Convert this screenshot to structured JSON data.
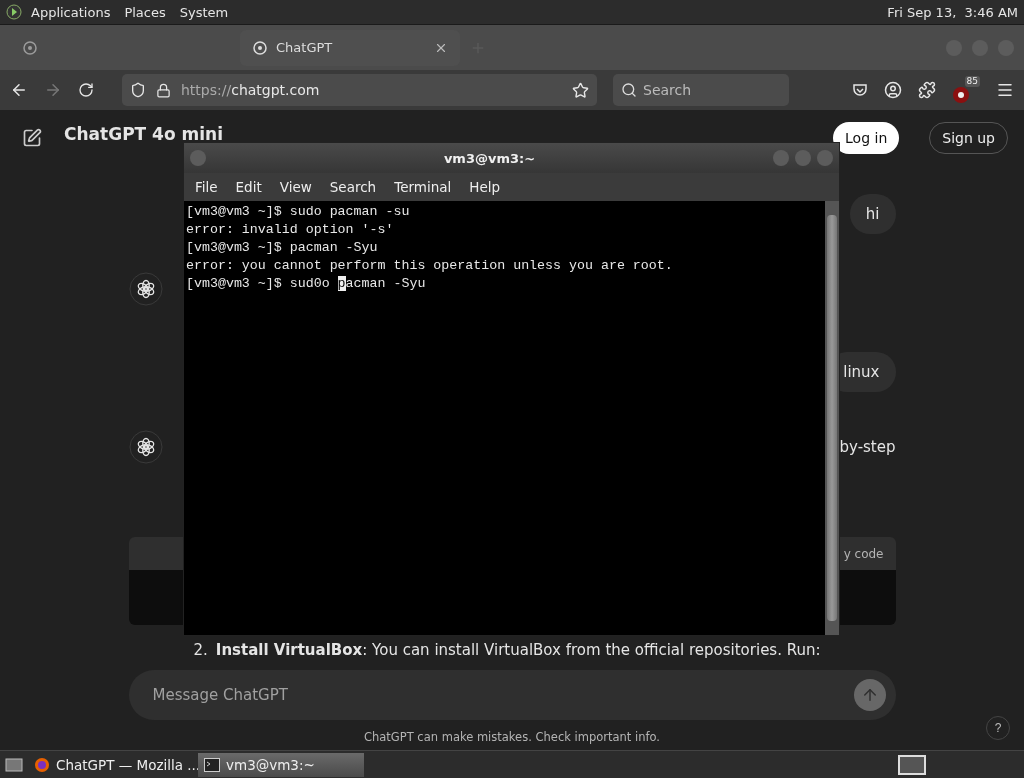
{
  "top_panel": {
    "menus": [
      "Applications",
      "Places",
      "System"
    ],
    "clock": "Fri Sep 13,  3:46 AM"
  },
  "browser": {
    "tabs": [
      {
        "selected": false
      },
      {
        "title": "ChatGPT",
        "selected": true
      }
    ],
    "url_scheme": "https://",
    "url_host": "chatgpt.com",
    "search_placeholder": "Search",
    "extension_badge": "85"
  },
  "chat": {
    "model": "ChatGPT 4o mini",
    "login": "Log in",
    "signup": "Sign up",
    "messages": [
      {
        "kind": "user",
        "text": "hi"
      },
      {
        "kind": "assistant"
      },
      {
        "kind": "user",
        "text": "linux"
      },
      {
        "kind": "assistant",
        "text": "by-step"
      },
      {
        "kind": "code",
        "header": "y code"
      },
      {
        "kind": "list",
        "number": "2.",
        "text": "**Install VirtualBox**: You can install VirtualBox from the official repositories. Run:"
      }
    ],
    "input_placeholder": "Message ChatGPT",
    "disclaimer": "ChatGPT can make mistakes. Check important info.",
    "help": "?"
  },
  "terminal": {
    "title": "vm3@vm3:~",
    "menu": [
      "File",
      "Edit",
      "View",
      "Search",
      "Terminal",
      "Help"
    ],
    "lines": [
      "[vm3@vm3 ~]$ sudo pacman -su",
      "error: invalid option '-s'",
      "[vm3@vm3 ~]$ pacman -Syu",
      "error: you cannot perform this operation unless you are root."
    ],
    "input_line": {
      "before": "[vm3@vm3 ~]$ sud0o ",
      "cursor": "p",
      "after": "acman -Syu"
    }
  },
  "taskbar": {
    "items": [
      {
        "kind": "browser",
        "title": "ChatGPT — Mozilla ...",
        "selected": false
      },
      {
        "kind": "terminal",
        "title": "vm3@vm3:~",
        "selected": true
      }
    ]
  }
}
